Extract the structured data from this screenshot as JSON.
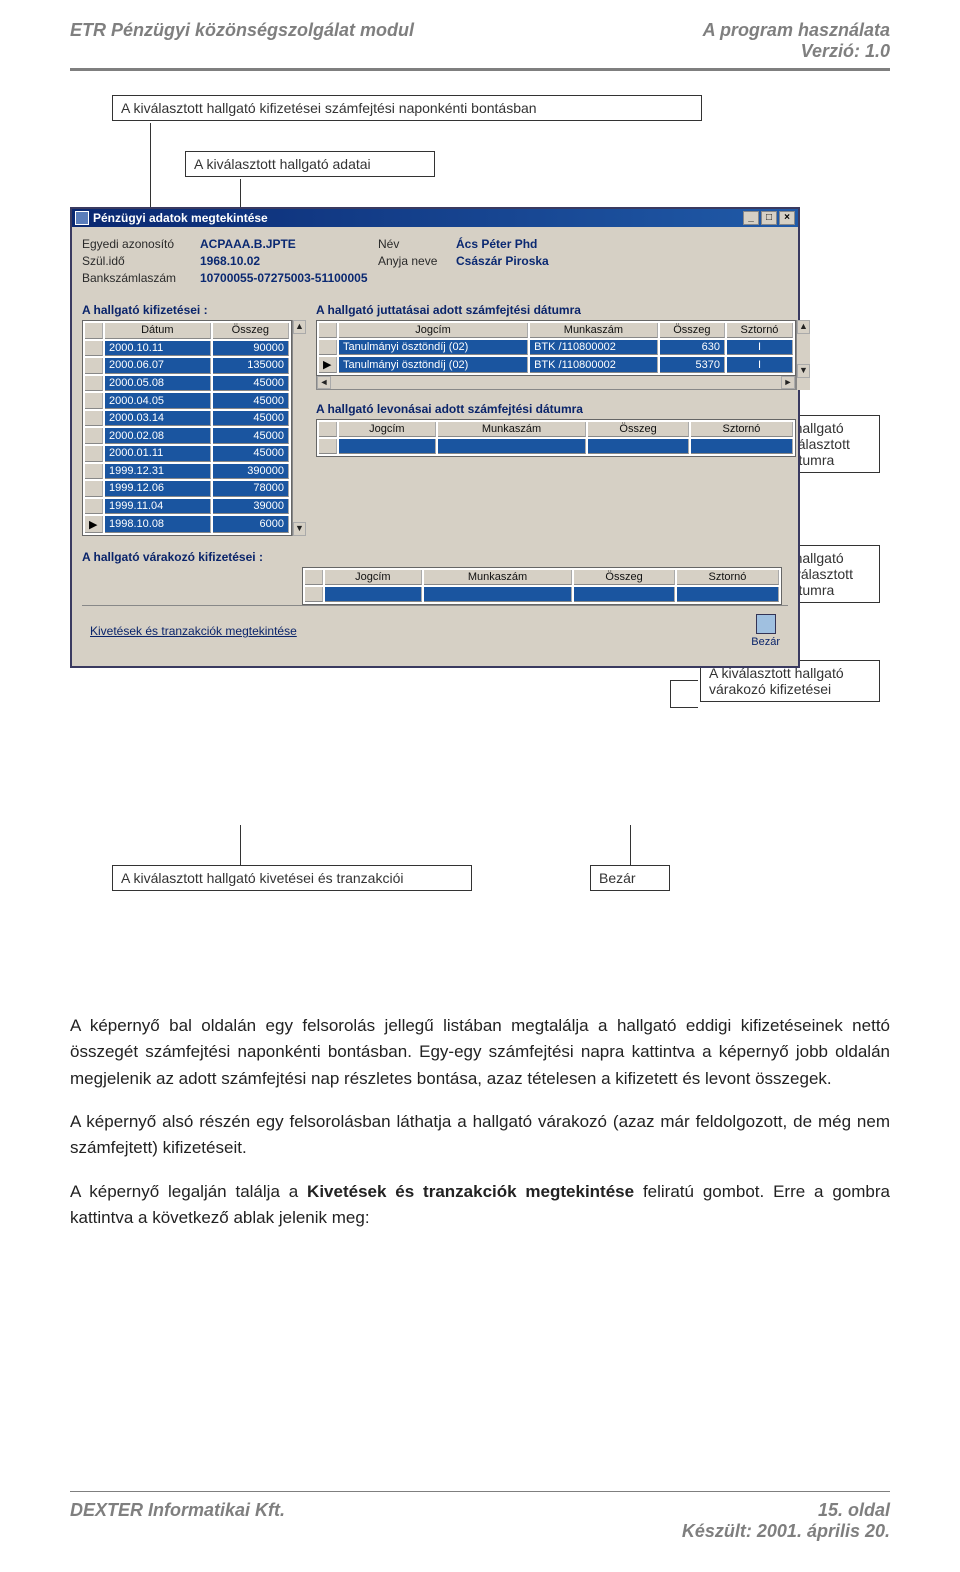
{
  "header": {
    "left": "ETR Pénzügyi közönségszolgálat modul",
    "right_line1": "A program használata",
    "right_line2": "Verzió: 1.0"
  },
  "callouts": {
    "bontas": "A kiválasztott hallgató kifizetései számfejtési naponkénti bontásban",
    "adatai": "A kiválasztott hallgató adatai",
    "juttatasai": "A kiválasztott hallgató juttatásai a kiválasztott számfejtési dátumra",
    "levonasai": "A kiválasztott hallgató levonásai a kiválasztott számfejtési dátumra",
    "varakozo": "A kiválasztott hallgató várakozó kifizetései",
    "kivetesei": "A kiválasztott hallgató kivetései és tranzakciói",
    "bezar": "Bezár"
  },
  "app": {
    "title": "Pénzügyi adatok megtekintése",
    "winbtn_min": "_",
    "winbtn_max": "□",
    "winbtn_close": "×",
    "fields": {
      "egyedi_label": "Egyedi azonosító",
      "egyedi_val": "ACPAAA.B.JPTE",
      "nev_label": "Név",
      "nev_val": "Ács Péter Phd",
      "szul_label": "Szül.idő",
      "szul_val": "1968.10.02",
      "anyja_label": "Anyja neve",
      "anyja_val": "Császár Piroska",
      "bank_label": "Bankszámlaszám",
      "bank_val": "10700055-07275003-51100005"
    },
    "sections": {
      "kif": "A hallgató kifizetései :",
      "jutt": "A hallgató juttatásai adott számfejtési dátumra",
      "lev": "A hallgató levonásai adott számfejtési dátumra",
      "var": "A hallgató várakozó kifizetései :"
    },
    "kif_headers": {
      "datum": "Dátum",
      "osszeg": "Összeg"
    },
    "kif_rows": [
      {
        "m": "",
        "datum": "2000.10.11",
        "osszeg": "90000"
      },
      {
        "m": "",
        "datum": "2000.06.07",
        "osszeg": "135000"
      },
      {
        "m": "",
        "datum": "2000.05.08",
        "osszeg": "45000"
      },
      {
        "m": "",
        "datum": "2000.04.05",
        "osszeg": "45000"
      },
      {
        "m": "",
        "datum": "2000.03.14",
        "osszeg": "45000"
      },
      {
        "m": "",
        "datum": "2000.02.08",
        "osszeg": "45000"
      },
      {
        "m": "",
        "datum": "2000.01.11",
        "osszeg": "45000"
      },
      {
        "m": "",
        "datum": "1999.12.31",
        "osszeg": "390000"
      },
      {
        "m": "",
        "datum": "1999.12.06",
        "osszeg": "78000"
      },
      {
        "m": "",
        "datum": "1999.11.04",
        "osszeg": "39000"
      },
      {
        "m": "▶",
        "datum": "1998.10.08",
        "osszeg": "6000"
      }
    ],
    "jutt_headers": {
      "jogcim": "Jogcím",
      "munkaszam": "Munkaszám",
      "osszeg": "Összeg",
      "sztorno": "Sztornó"
    },
    "jutt_rows": [
      {
        "m": "",
        "jogcim": "Tanulmányi ösztöndíj (02)",
        "munkaszam": "BTK /110800002",
        "osszeg": "630",
        "sztorno": "I"
      },
      {
        "m": "▶",
        "jogcim": "Tanulmányi ösztöndíj (02)",
        "munkaszam": "BTK /110800002",
        "osszeg": "5370",
        "sztorno": "I"
      }
    ],
    "lev_headers": {
      "jogcim": "Jogcím",
      "munkaszam": "Munkaszám",
      "osszeg": "Összeg",
      "sztorno": "Sztornó"
    },
    "var_headers": {
      "jogcim": "Jogcím",
      "munkaszam": "Munkaszám",
      "osszeg": "Összeg",
      "sztorno": "Sztornó"
    },
    "bottom_link": "Kivetések és tranzakciók megtekintése",
    "bezar_label": "Bezár",
    "scroll_left": "◄",
    "scroll_right": "►",
    "scroll_up": "▲",
    "scroll_down": "▼"
  },
  "body": {
    "p1a": "A képernyő bal oldalán egy felsorolás jellegű listában megtalálja a hallgató eddigi kifizetéseinek nettó összegét számfejtési naponkénti bontásban. Egy-egy számfejtési napra kattintva a képernyő jobb oldalán megjelenik az adott számfejtési nap részletes bontása, azaz tételesen a kifizetett és levont összegek.",
    "p2": "A képernyő alsó részén egy felsorolásban láthatja a hallgató várakozó (azaz már feldolgozott, de még nem számfejtett) kifizetéseit.",
    "p3a": "A képernyő legalján találja a ",
    "p3b": "Kivetések és tranzakciók megtekintése",
    "p3c": " feliratú gombot. Erre a gombra kattintva a következő ablak jelenik meg:"
  },
  "footer": {
    "left": "DEXTER Informatikai Kft.",
    "right_line1": "15. oldal",
    "right_line2": "Készült: 2001. április 20."
  }
}
